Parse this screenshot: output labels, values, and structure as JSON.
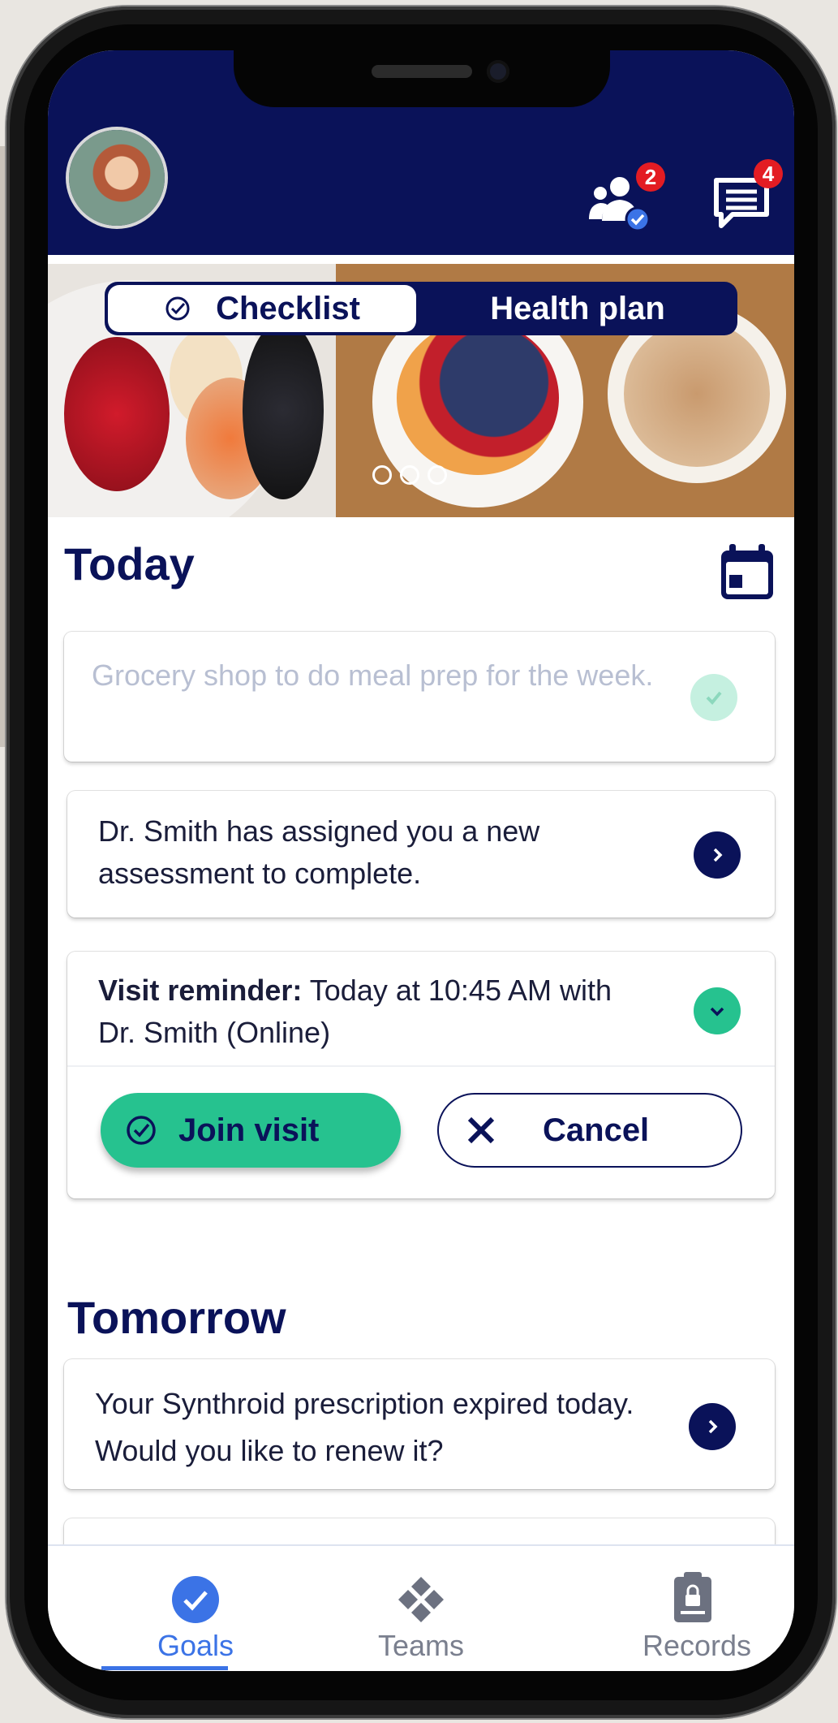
{
  "header": {
    "team_badge_count": "2",
    "messages_badge_count": "4"
  },
  "segment": {
    "active_label": "Checklist",
    "inactive_label": "Health plan"
  },
  "today": {
    "title": "Today",
    "items": [
      {
        "text": "Grocery shop to do meal prep for the week."
      },
      {
        "text": "Dr. Smith has assigned you a new assessment to complete."
      }
    ],
    "visit": {
      "label": "Visit reminder:",
      "detail": "Today at 10:45 AM with Dr. Smith (Online)",
      "join_label": "Join visit",
      "cancel_label": "Cancel"
    }
  },
  "tomorrow": {
    "title": "Tomorrow",
    "items": [
      {
        "text": "Your Synthroid prescription expired today. Would you like to renew it?"
      }
    ]
  },
  "nav": {
    "items": [
      {
        "label": "Goals",
        "icon": "check-circle-icon",
        "active": true
      },
      {
        "label": "Teams",
        "icon": "teams-icon",
        "active": false
      },
      {
        "label": "Records",
        "icon": "clipboard-lock-icon",
        "active": false
      }
    ]
  },
  "colors": {
    "navy": "#0a1259",
    "green": "#26c28f",
    "badge_red": "#e31c23",
    "nav_active": "#3b73e6",
    "nav_inactive": "#7a7f8e"
  }
}
